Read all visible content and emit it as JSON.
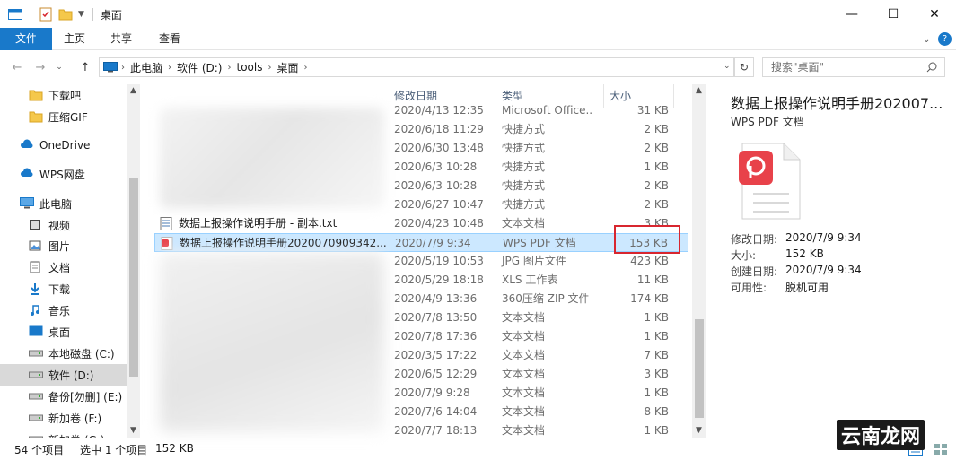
{
  "window": {
    "title": "桌面",
    "minimize_glyph": "—",
    "maximize_glyph": "☐",
    "close_glyph": "✕"
  },
  "ribbon": {
    "tabs": [
      "文件",
      "主页",
      "共享",
      "查看"
    ]
  },
  "address": {
    "crumbs": [
      "此电脑",
      "软件 (D:)",
      "tools",
      "桌面"
    ],
    "search_placeholder": "搜索\"桌面\""
  },
  "sidebar": {
    "items": [
      {
        "label": "下载吧",
        "icon": "folder-icon"
      },
      {
        "label": "压缩GIF",
        "icon": "folder-icon"
      },
      {
        "label": "OneDrive",
        "icon": "cloud-icon"
      },
      {
        "label": "WPS网盘",
        "icon": "cloud-icon"
      },
      {
        "label": "此电脑",
        "icon": "computer-icon"
      },
      {
        "label": "视频",
        "icon": "video-icon"
      },
      {
        "label": "图片",
        "icon": "picture-icon"
      },
      {
        "label": "文档",
        "icon": "document-icon"
      },
      {
        "label": "下载",
        "icon": "download-icon"
      },
      {
        "label": "音乐",
        "icon": "music-icon"
      },
      {
        "label": "桌面",
        "icon": "desktop-icon"
      },
      {
        "label": "本地磁盘 (C:)",
        "icon": "drive-icon"
      },
      {
        "label": "软件 (D:)",
        "icon": "drive-icon"
      },
      {
        "label": "备份[勿删] (E:)",
        "icon": "drive-icon"
      },
      {
        "label": "新加卷 (F:)",
        "icon": "drive-icon"
      },
      {
        "label": "新加卷 (G:)",
        "icon": "drive-icon"
      }
    ]
  },
  "list": {
    "columns": [
      "修改日期",
      "类型",
      "大小"
    ],
    "rows": [
      {
        "name": "",
        "date": "2020/4/13 12:35",
        "type": "Microsoft Office...",
        "size": "31 KB"
      },
      {
        "name": "",
        "date": "2020/6/18 11:29",
        "type": "快捷方式",
        "size": "2 KB"
      },
      {
        "name": "",
        "date": "2020/6/30 13:48",
        "type": "快捷方式",
        "size": "2 KB"
      },
      {
        "name": "",
        "date": "2020/6/3 10:28",
        "type": "快捷方式",
        "size": "1 KB"
      },
      {
        "name": "",
        "date": "2020/6/3 10:28",
        "type": "快捷方式",
        "size": "2 KB"
      },
      {
        "name": "",
        "date": "2020/6/27 10:47",
        "type": "快捷方式",
        "size": "2 KB"
      },
      {
        "name": "数据上报操作说明手册 - 副本.txt",
        "date": "2020/4/23 10:48",
        "type": "文本文档",
        "size": "3 KB"
      },
      {
        "name": "数据上报操作说明手册2020070909342...",
        "date": "2020/7/9 9:34",
        "type": "WPS PDF 文档",
        "size": "153 KB"
      },
      {
        "name": "",
        "date": "2020/5/19 10:53",
        "type": "JPG 图片文件",
        "size": "423 KB"
      },
      {
        "name": "",
        "date": "2020/5/29 18:18",
        "type": "XLS 工作表",
        "size": "11 KB"
      },
      {
        "name": "",
        "date": "2020/4/9 13:36",
        "type": "360压缩 ZIP 文件",
        "size": "174 KB"
      },
      {
        "name": "",
        "date": "2020/7/8 13:50",
        "type": "文本文档",
        "size": "1 KB"
      },
      {
        "name": "",
        "date": "2020/7/8 17:36",
        "type": "文本文档",
        "size": "1 KB"
      },
      {
        "name": "",
        "date": "2020/3/5 17:22",
        "type": "文本文档",
        "size": "7 KB"
      },
      {
        "name": "",
        "date": "2020/6/5 12:29",
        "type": "文本文档",
        "size": "3 KB"
      },
      {
        "name": "",
        "date": "2020/7/9 9:28",
        "type": "文本文档",
        "size": "1 KB"
      },
      {
        "name": "",
        "date": "2020/7/6 14:04",
        "type": "文本文档",
        "size": "8 KB"
      },
      {
        "name": "",
        "date": "2020/7/7 18:13",
        "type": "文本文档",
        "size": "1 KB"
      }
    ]
  },
  "preview": {
    "title": "数据上报操作说明手册202007...",
    "subtitle": "WPS PDF 文档",
    "props": [
      {
        "key": "修改日期:",
        "value": "2020/7/9 9:34"
      },
      {
        "key": "大小:",
        "value": "152 KB"
      },
      {
        "key": "创建日期:",
        "value": "2020/7/9 9:34"
      },
      {
        "key": "可用性:",
        "value": "脱机可用"
      }
    ]
  },
  "status": {
    "count": "54 个项目",
    "selected": "选中 1 个项目",
    "size": "152 KB"
  },
  "watermark": "云南龙网",
  "colors": {
    "accent": "#1979ca",
    "selection": "#cce8ff",
    "highlight_box": "#d8262f",
    "pdf_red": "#e8424a"
  }
}
